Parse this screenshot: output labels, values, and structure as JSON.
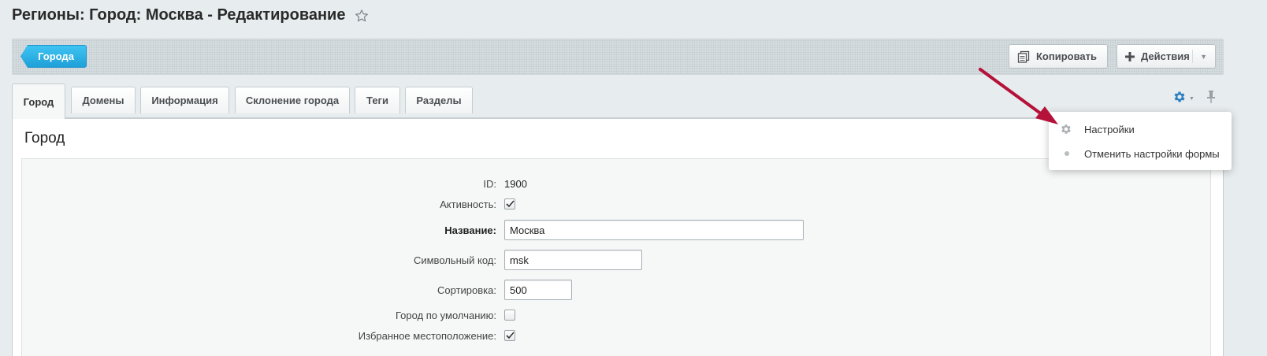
{
  "header": {
    "title": "Регионы: Город: Москва - Редактирование"
  },
  "toolbar": {
    "back_label": "Города",
    "copy_label": "Копировать",
    "actions_label": "Действия"
  },
  "tabs": [
    {
      "label": "Город"
    },
    {
      "label": "Домены"
    },
    {
      "label": "Информация"
    },
    {
      "label": "Склонение города"
    },
    {
      "label": "Теги"
    },
    {
      "label": "Разделы"
    }
  ],
  "settings_menu": {
    "items": [
      {
        "label": "Настройки",
        "icon": "gear-icon"
      },
      {
        "label": "Отменить настройки формы",
        "icon": "dot-icon"
      }
    ]
  },
  "form": {
    "section_title": "Город",
    "id_label": "ID:",
    "id_value": "1900",
    "active_label": "Активность:",
    "active_checked": true,
    "name_label": "Название:",
    "name_value": "Москва",
    "code_label": "Символьный код:",
    "code_value": "msk",
    "sort_label": "Сортировка:",
    "sort_value": "500",
    "default_label": "Город по умолчанию:",
    "default_checked": false,
    "fav_label": "Избранное местоположение:",
    "fav_checked": true
  },
  "colors": {
    "accent": "#1fa0d8",
    "annotation_arrow": "#b5123a",
    "gear": "#2d7fc0"
  }
}
